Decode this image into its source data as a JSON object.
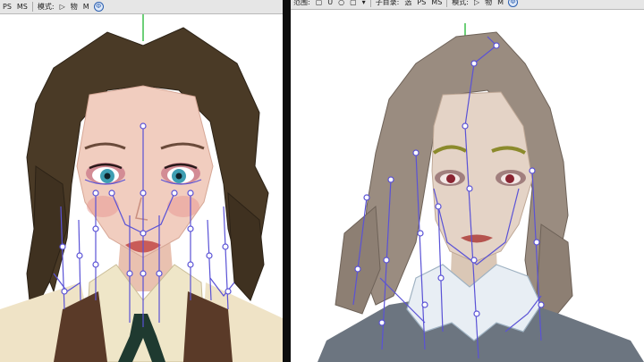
{
  "left_toolbar": {
    "items": [
      "PS",
      "MS",
      "模式:",
      "▷",
      "物",
      "M"
    ],
    "globe": "Ф"
  },
  "right_toolbar": {
    "items": [
      "范围:",
      "▢",
      "Ü",
      "○",
      "▢",
      "▾",
      "子目录:",
      "选",
      "PS",
      "MS",
      "模式:",
      "▷",
      "物",
      "M"
    ],
    "globe": "Ф"
  },
  "colors": {
    "toolbar_bg": "#e6e6e6",
    "viewport_bg": "#ffffff",
    "bone_rig": "#5a52d6",
    "divider": "#0d0d0d"
  },
  "icons": [
    "globe-icon",
    "play-icon"
  ]
}
